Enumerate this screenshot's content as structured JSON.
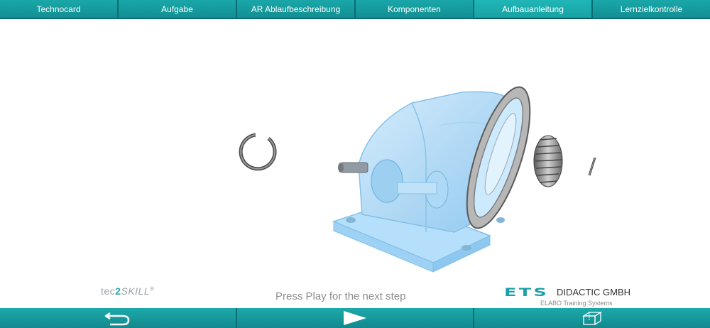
{
  "tabs": [
    {
      "label": "Technocard",
      "active": false
    },
    {
      "label": "Aufgabe",
      "active": false
    },
    {
      "label": "AR Ablaufbeschreibung",
      "active": false
    },
    {
      "label": "Komponenten",
      "active": false
    },
    {
      "label": "Aufbauanleitung",
      "active": true
    },
    {
      "label": "Lernzielkontrolle",
      "active": false
    }
  ],
  "status": {
    "text": "Press Play for the next step"
  },
  "branding": {
    "tec2skill": {
      "prefix": "tec",
      "two": "2",
      "suffix": "SKILL",
      "reg": "®"
    },
    "ets": {
      "mark": "ETS",
      "name": "DIDACTIC GMBH",
      "sub": "ELABO Training Systems"
    }
  },
  "bottom_buttons": [
    {
      "icon": "back-arrow-icon"
    },
    {
      "icon": "play-icon"
    },
    {
      "icon": "3d-box-icon"
    }
  ],
  "colors": {
    "accent": "#1aa5a8",
    "dark_accent": "#0b6d73",
    "part_blue": "#9fd3f5"
  }
}
